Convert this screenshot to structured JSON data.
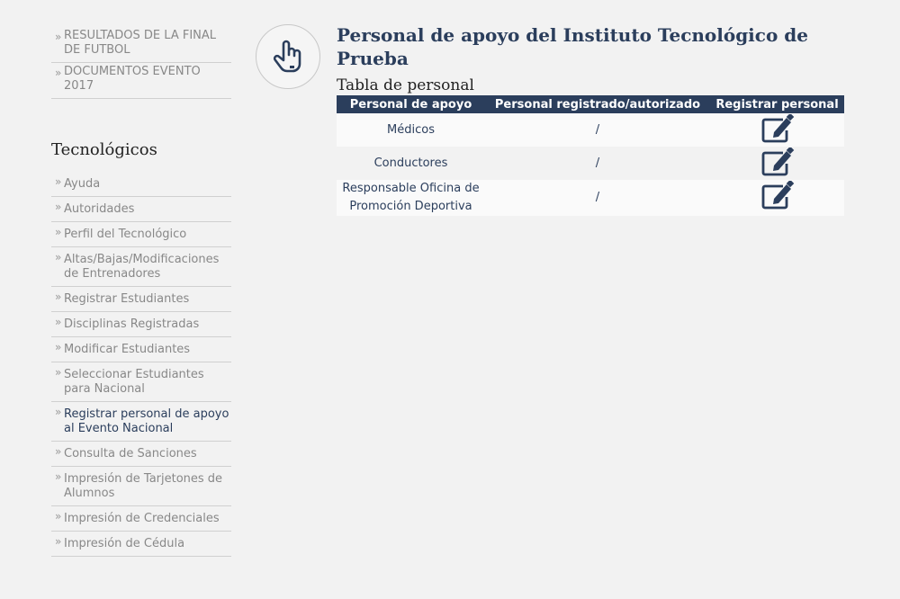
{
  "sidebar": {
    "top_items": [
      {
        "label": "RESULTADOS DE LA FINAL DE FUTBOL"
      },
      {
        "label": "DOCUMENTOS EVENTO 2017"
      }
    ],
    "section_title": "Tecnológicos",
    "items": [
      {
        "label": "Ayuda"
      },
      {
        "label": "Autoridades"
      },
      {
        "label": "Perfil del Tecnológico"
      },
      {
        "label": "Altas/Bajas/Modificaciones de Entrenadores"
      },
      {
        "label": "Registrar Estudiantes"
      },
      {
        "label": "Disciplinas Registradas"
      },
      {
        "label": "Modificar Estudiantes"
      },
      {
        "label": "Seleccionar Estudiantes para Nacional"
      },
      {
        "label": "Registrar personal de apoyo al Evento Nacional"
      },
      {
        "label": "Consulta de Sanciones"
      },
      {
        "label": "Impresión de Tarjetones de Alumnos"
      },
      {
        "label": "Impresión de Credenciales"
      },
      {
        "label": "Impresión de Cédula"
      }
    ],
    "arrow_glyph": "»"
  },
  "main": {
    "title": "Personal de apoyo del Instituto Tecnológico de Prueba",
    "subtitle": "Tabla de personal",
    "table": {
      "headers": [
        "Personal de apoyo",
        "Personal registrado/autorizado",
        "Registrar personal"
      ],
      "rows": [
        {
          "personal": "Médicos",
          "registrado": "/"
        },
        {
          "personal": "Conductores",
          "registrado": "/"
        },
        {
          "personal": "Responsable Oficina de Promoción Deportiva",
          "registrado": "/"
        }
      ]
    }
  },
  "icons": {
    "hand": "pointing-hand-icon",
    "edit": "edit-icon"
  },
  "colors": {
    "accent": "#2b3e5c",
    "background": "#f2f2f2",
    "muted_text": "#888888"
  }
}
